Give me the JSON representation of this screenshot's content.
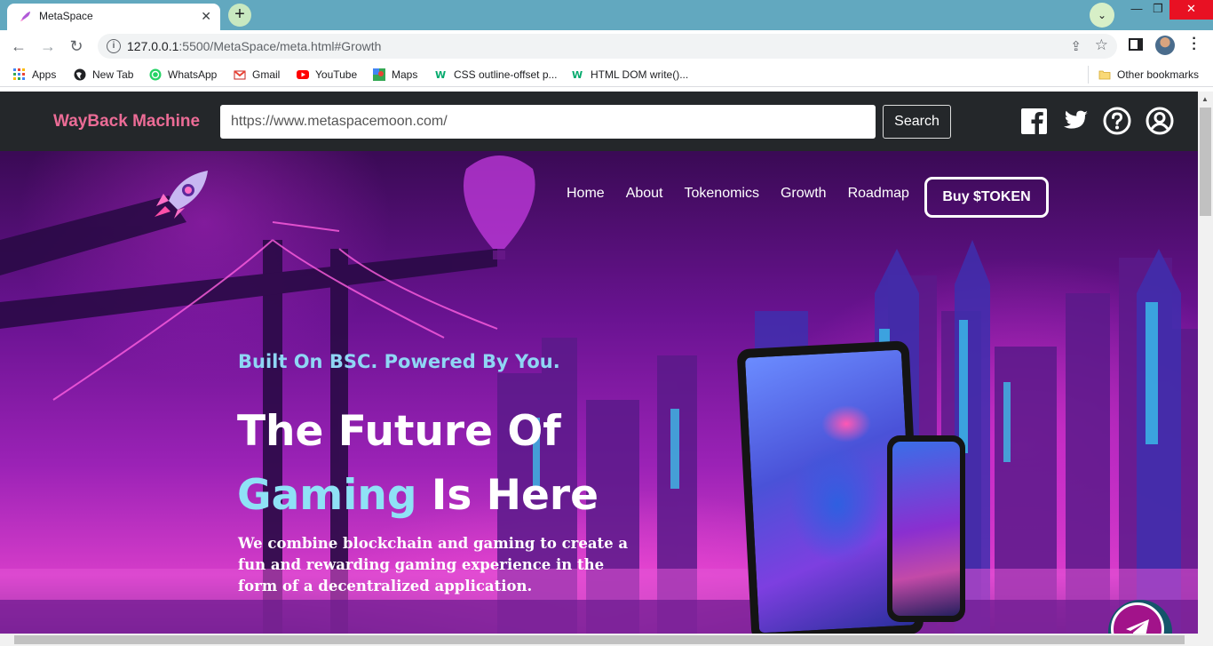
{
  "browser": {
    "tab_title": "MetaSpace",
    "new_tab_symbol": "+",
    "window_controls": {
      "minimize": "—",
      "maximize": "❐",
      "close": "✕"
    },
    "url_host": "127.0.0.1",
    "url_rest": ":5500/MetaSpace/meta.html#Growth",
    "bookmarks": [
      {
        "label": "Apps",
        "icon": "apps-grid-icon",
        "color": "#4285f4"
      },
      {
        "label": "New Tab",
        "icon": "globe-icon",
        "color": "#202124"
      },
      {
        "label": "WhatsApp",
        "icon": "whatsapp-icon",
        "color": "#25d366"
      },
      {
        "label": "Gmail",
        "icon": "gmail-icon",
        "color": "#ea4335"
      },
      {
        "label": "YouTube",
        "icon": "youtube-icon",
        "color": "#ff0000"
      },
      {
        "label": "Maps",
        "icon": "maps-icon",
        "color": "#34a853"
      },
      {
        "label": "CSS outline-offset p...",
        "icon": "w3schools-icon",
        "color": "#04aa6d"
      },
      {
        "label": "HTML DOM write()...",
        "icon": "w3schools-icon",
        "color": "#04aa6d"
      }
    ],
    "other_bookmarks": "Other bookmarks"
  },
  "wayback": {
    "title": "WayBack Machine",
    "url_value": "https://www.metaspacemoon.com/",
    "search_label": "Search",
    "social_icons": [
      "facebook-icon",
      "twitter-icon",
      "help-icon",
      "account-icon"
    ]
  },
  "site": {
    "nav": [
      "Home",
      "About",
      "Tokenomics",
      "Growth",
      "Roadmap"
    ],
    "buy_label": "Buy $TOKEN",
    "tagline": "Built On BSC. Powered By You.",
    "headline_line1": "The Future Of",
    "headline_accent": "Gaming",
    "headline_rest": " Is Here",
    "description": "We combine blockchain and gaming to create a fun and rewarding gaming experience in the form of a decentralized application."
  },
  "colors": {
    "tabstrip": "#62a8bf",
    "wayback_title": "#ec6c96",
    "accent_cyan": "#8fe2f6",
    "telegram": "#a2138a"
  }
}
